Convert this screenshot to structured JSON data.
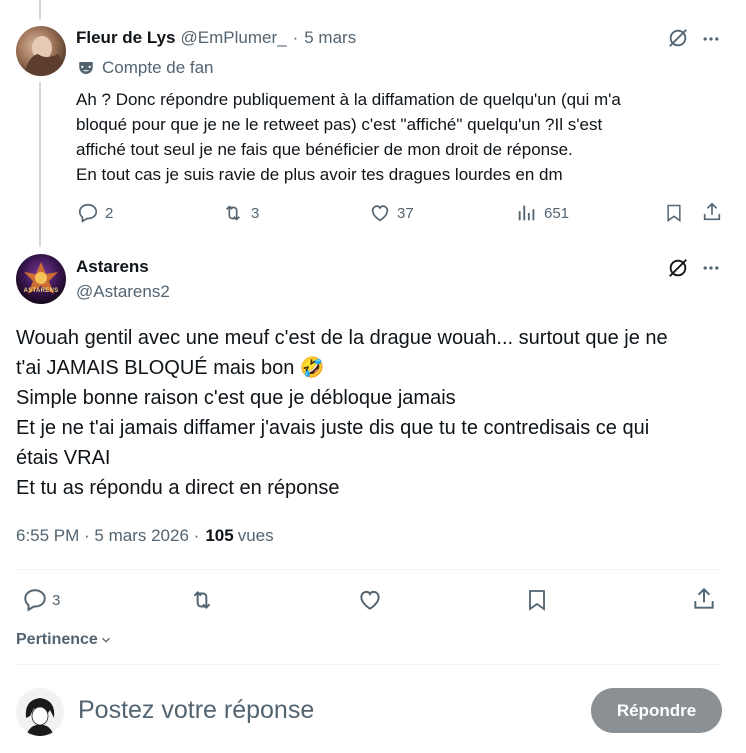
{
  "parent_tweet": {
    "display_name": "Fleur de Lys",
    "handle": "@EmPlumer_",
    "separator": "·",
    "time": "5 mars",
    "badge_label": "Compte de fan",
    "text": "Ah ? Donc répondre publiquement à la diffamation de quelqu'un (qui m'a\nbloqué pour que je ne le retweet pas) c'est \"affiché\" quelqu'un ?Il s'est\naffiché tout seul je ne fais que bénéficier de mon droit de réponse.\nEn tout cas je suis ravie de plus avoir tes dragues lourdes en dm",
    "replies": "2",
    "retweets": "3",
    "likes": "37",
    "views": "651"
  },
  "main_tweet": {
    "display_name": "Astarens",
    "handle": "@Astarens2",
    "avatar_text": "ASTARENS",
    "text_before_emoji": "Wouah gentil avec une meuf c'est de la drague wouah... surtout que je ne\nt'ai JAMAIS BLOQUÉ mais bon ",
    "emoji": "🤣",
    "text_after_emoji": "\nSimple bonne raison c'est que je débloque jamais\nEt je ne t'ai jamais diffamer j'avais juste dis que tu te contredisais ce qui\nétais VRAI\nEt tu as répondu a direct en réponse",
    "timestamp": "6:55 PM · 5 mars 2026 ·",
    "view_count": "105",
    "views_label": "vues",
    "replies": "3"
  },
  "sort": {
    "label": "Pertinence"
  },
  "composer": {
    "placeholder": "Postez votre réponse",
    "reply_button": "Répondre"
  },
  "icons": {
    "grok": "grok-icon",
    "more": "more-icon",
    "fan_badge": "mask-icon",
    "reply": "reply-icon",
    "retweet": "retweet-icon",
    "like": "heart-icon",
    "views": "views-icon",
    "bookmark": "bookmark-icon",
    "share": "share-icon",
    "chevron": "chevron-down-icon"
  },
  "colors": {
    "text": "#0f1419",
    "muted": "#536471",
    "thread_line": "#cfd9de",
    "button_disabled": "#8b9094"
  }
}
